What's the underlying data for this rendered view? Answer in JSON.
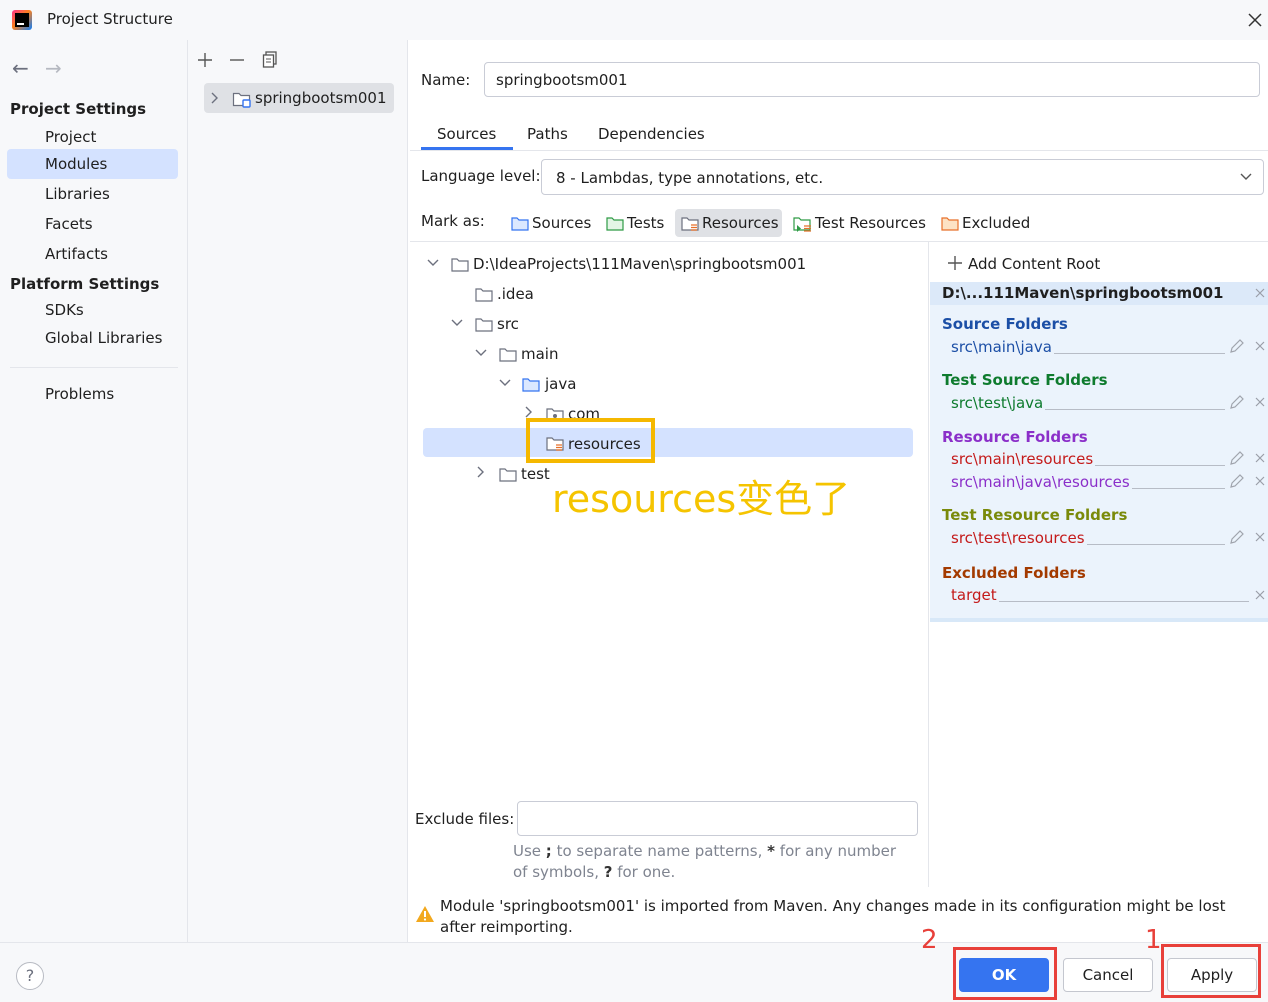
{
  "window": {
    "title": "Project Structure"
  },
  "nav": {
    "back": "←",
    "forward": "→",
    "project_settings_header": "Project Settings",
    "project_settings_items": [
      "Project",
      "Modules",
      "Libraries",
      "Facets",
      "Artifacts"
    ],
    "selected": "Modules",
    "platform_settings_header": "Platform Settings",
    "platform_settings_items": [
      "SDKs",
      "Global Libraries"
    ],
    "problems": "Problems"
  },
  "module_list": {
    "items": [
      "springbootsm001"
    ]
  },
  "module": {
    "name_label": "Name:",
    "name_value": "springbootsm001",
    "tabs": [
      "Sources",
      "Paths",
      "Dependencies"
    ],
    "active_tab": "Sources",
    "language_level_label": "Language level:",
    "language_level_value": "8 - Lambdas, type annotations, etc.",
    "mark_as_label": "Mark as:",
    "mark_as_buttons": [
      "Sources",
      "Tests",
      "Resources",
      "Test Resources",
      "Excluded"
    ],
    "tree": {
      "root": "D:\\IdeaProjects\\111Maven\\springbootsm001",
      "idea": ".idea",
      "src": "src",
      "main": "main",
      "java": "java",
      "com": "com",
      "resources": "resources",
      "test": "test"
    },
    "annotation": "resources变色了",
    "exclude_files_label": "Exclude files:",
    "exclude_files_value": "",
    "exclude_hint_prefix": "Use ",
    "exclude_hint_sep": ";",
    "exclude_hint_mid": " to separate name patterns, ",
    "exclude_hint_star": "*",
    "exclude_hint_mid2": " for any number of symbols, ",
    "exclude_hint_q": "?",
    "exclude_hint_end": " for one."
  },
  "content_root": {
    "add_label": "Add Content Root",
    "root_path": "D:\\...111Maven\\springbootsm001",
    "source_folders_title": "Source Folders",
    "source_folders": [
      "src\\main\\java"
    ],
    "test_source_folders_title": "Test Source Folders",
    "test_source_folders": [
      "src\\test\\java"
    ],
    "resource_folders_title": "Resource Folders",
    "resource_folders": [
      "src\\main\\resources",
      "src\\main\\java\\resources"
    ],
    "test_resource_folders_title": "Test Resource Folders",
    "test_resource_folders": [
      "src\\test\\resources"
    ],
    "excluded_folders_title": "Excluded Folders",
    "excluded_folders": [
      "target"
    ]
  },
  "warning": "Module 'springbootsm001' is imported from Maven. Any changes made in its configuration might be lost after reimporting.",
  "buttons": {
    "help": "?",
    "ok": "OK",
    "cancel": "Cancel",
    "apply": "Apply"
  },
  "step_marks": {
    "ok": "2",
    "apply": "1"
  },
  "colors": {
    "accent": "#3574f0",
    "selection": "#d4e2ff",
    "source": "#1c4fa6",
    "test": "#0e7b2e",
    "resource": "#8b2fc9",
    "test_resource": "#7a8a0a",
    "excluded": "#a33a00",
    "red_path": "#c41a1a",
    "highlight": "#f5b800",
    "annotation": "#f5c400",
    "red_box": "#e8403a"
  }
}
